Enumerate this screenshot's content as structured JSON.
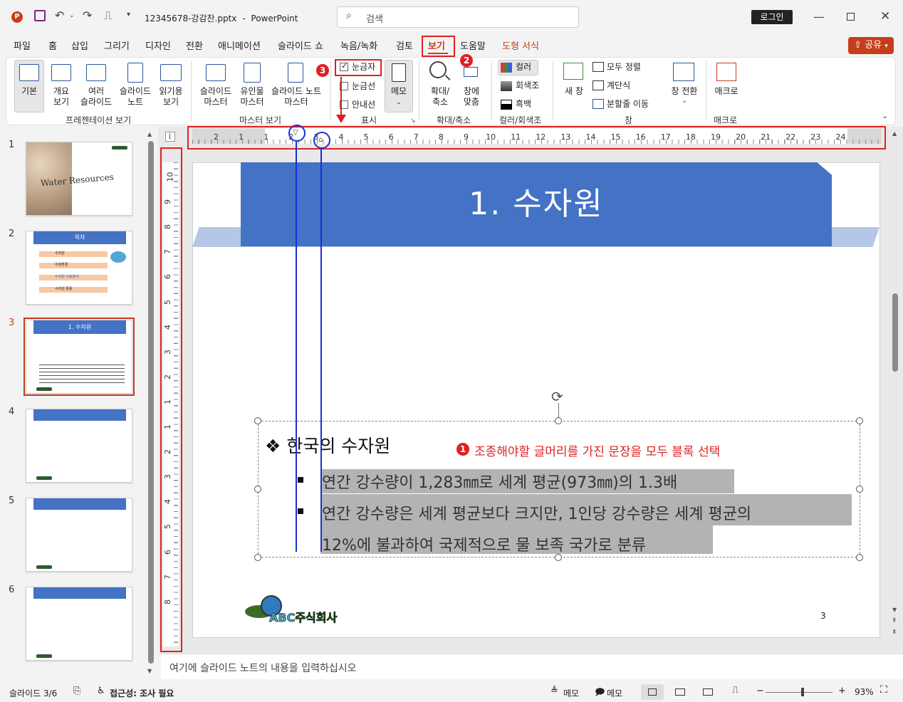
{
  "titlebar": {
    "filename": "12345678-강감찬.pptx",
    "separator": "-",
    "app_name": "PowerPoint",
    "search_placeholder": "검색",
    "login_label": "로그인"
  },
  "menu": {
    "tabs": [
      "파일",
      "홈",
      "삽입",
      "그리기",
      "디자인",
      "전환",
      "애니메이션",
      "슬라이드 쇼",
      "녹음/녹화",
      "검토",
      "보기",
      "도움말",
      "도형 서식"
    ],
    "active_tab": "보기",
    "share_label": "공유"
  },
  "ribbon": {
    "presentation_views": {
      "normal": "기본",
      "outline": [
        "개요",
        "보기"
      ],
      "sorter": [
        "여러",
        "슬라이드"
      ],
      "notes": [
        "슬라이드",
        "노트"
      ],
      "reading": [
        "읽기용",
        "보기"
      ],
      "label": "프레젠테이션 보기"
    },
    "master_views": {
      "slide_master": [
        "슬라이드",
        "마스터"
      ],
      "handout_master": [
        "유인물",
        "마스터"
      ],
      "notes_master": [
        "슬라이드 노트",
        "마스터"
      ],
      "label": "마스터 보기"
    },
    "show": {
      "ruler": "눈금자",
      "ruler_checked": true,
      "gridlines": "눈금선",
      "guides": "안내선",
      "notes": "메모",
      "label": "표시"
    },
    "zoom": {
      "zoom": [
        "확대/",
        "축소"
      ],
      "fit": [
        "창에",
        "맞춤"
      ],
      "label": "확대/축소"
    },
    "color": {
      "color": "컬러",
      "grayscale": "회색조",
      "bw": "흑백",
      "label": "컬러/회색조"
    },
    "window": {
      "new_window": "새 창",
      "arrange_all": "모두 정렬",
      "cascade": "계단식",
      "move_split": "분할줄 이동",
      "switch": "창 전환",
      "label": "창"
    },
    "macros": {
      "macros": "매크로",
      "label": "매크로"
    }
  },
  "annotations": {
    "badge1": "1",
    "badge2": "2",
    "badge3": "3",
    "note1": "조종해야할 글머리를 가진 문장을 모두 블록 선택"
  },
  "thumbnails": [
    {
      "num": "1",
      "title": "Water Resources"
    },
    {
      "num": "2",
      "title": "목차",
      "items": [
        "수자원",
        "수질환경",
        "수자원 지표분석",
        "수자원 활용"
      ]
    },
    {
      "num": "3",
      "title": "1. 수자원"
    },
    {
      "num": "4"
    },
    {
      "num": "5"
    },
    {
      "num": "6"
    }
  ],
  "ruler": {
    "h_ticks": [
      "2",
      "1",
      "1",
      "2",
      "3",
      "4",
      "5",
      "6",
      "7",
      "8",
      "9",
      "10",
      "11",
      "12",
      "13",
      "14",
      "15",
      "16",
      "17",
      "18",
      "19",
      "20",
      "21",
      "22",
      "23",
      "24"
    ],
    "v_ticks": [
      "10",
      "9",
      "8",
      "7",
      "6",
      "5",
      "4",
      "3",
      "2",
      "1",
      "1",
      "2",
      "3",
      "4",
      "5",
      "6",
      "7",
      "8"
    ]
  },
  "slide": {
    "title": "1. 수자원",
    "heading": "❖ 한국의 수자원",
    "bullet1": "연간 강수량이 1,283㎜로 세계 평균(973㎜)의 1.3배",
    "bullet2_line1": "연간 강수량은 세계 평균보다 크지만, 1인당 강수량은 세계 평균의",
    "bullet2_line2": "12%에 불과하여 국제적으로 물 보족 국가로 분류",
    "page_number": "3",
    "logo_text": "ABC주식회사"
  },
  "notes_placeholder": "여기에 슬라이드 노트의 내용을 입력하십시오",
  "status": {
    "slide_count": "슬라이드 3/6",
    "accessibility": "접근성: 조사 필요",
    "notes_btn": "메모",
    "comments_btn": "메모",
    "zoom_level": "93%",
    "minus": "−",
    "plus": "+",
    "zoom_fraction": 0.55
  },
  "colors": {
    "accent_red": "#e02020",
    "brand": "#c43e1c",
    "slide_blue": "#4472c4",
    "annotation_blue": "#1a2fd6"
  }
}
